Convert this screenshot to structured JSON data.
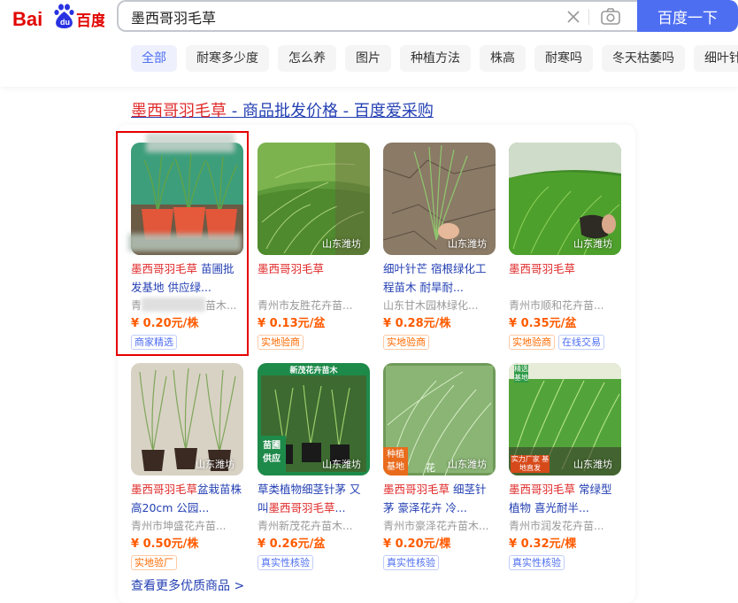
{
  "header": {
    "logo_text": "Bai百度",
    "search_value": "墨西哥羽毛草",
    "search_button": "百度一下",
    "tabs": [
      "全部",
      "耐寒多少度",
      "怎么养",
      "图片",
      "种植方法",
      "株高",
      "耐寒吗",
      "冬天枯萎吗",
      "细叶针"
    ]
  },
  "result": {
    "title_highlight": "墨西哥羽毛草",
    "title_rest": " - 商品批发价格 - 百度爱采购"
  },
  "products": [
    {
      "name_hl": "墨西哥羽毛草",
      "name_rest": " 苗圃批发基地 供应绿...",
      "shop": "青　　　　　　苗木...",
      "price": "¥ 0.20元/株",
      "badges": [
        {
          "text": "商家精选",
          "style": "blue"
        }
      ],
      "location": ""
    },
    {
      "name_hl": "墨西哥羽毛草",
      "name_rest": "",
      "shop": "青州市友胜花卉苗...",
      "price": "¥ 0.13元/盆",
      "badges": [
        {
          "text": "实地验商",
          "style": "orange"
        }
      ],
      "location": "山东潍坊"
    },
    {
      "name_hl": "",
      "name_rest": "细叶针芒 宿根绿化工程苗木 耐旱耐...",
      "shop": "山东甘木园林绿化...",
      "price": "¥ 0.28元/株",
      "badges": [
        {
          "text": "实地验商",
          "style": "orange"
        }
      ],
      "location": "山东潍坊"
    },
    {
      "name_hl": "墨西哥羽毛草",
      "name_rest": "",
      "shop": "青州市顺和花卉苗...",
      "price": "¥ 0.35元/盆",
      "badges": [
        {
          "text": "实地验商",
          "style": "orange"
        },
        {
          "text": "在线交易",
          "style": "blue"
        }
      ],
      "location": "山东潍坊"
    },
    {
      "name_hl": "墨西哥羽毛草",
      "name_rest": "盆栽苗株高20cm 公园...",
      "shop": "青州市坤盛花卉苗...",
      "price": "¥ 0.50元/株",
      "badges": [
        {
          "text": "实地验厂",
          "style": "orange"
        }
      ],
      "location": "山东潍坊"
    },
    {
      "name_pre": "草类植物细茎针茅 又叫",
      "name_hl": "墨西哥羽毛草",
      "name_rest": "...",
      "shop": "青州新茂花卉苗木...",
      "price": "¥ 0.26元/盆",
      "badges": [
        {
          "text": "真实性核验",
          "style": "blue"
        }
      ],
      "location": "山东潍坊",
      "overlay_top": "新茂花卉苗木",
      "overlay_left": "苗圃供应"
    },
    {
      "name_hl": "墨西哥羽毛草",
      "name_rest": " 细茎针茅 豪泽花卉 冷...",
      "shop": "青州市豪泽花卉苗木...",
      "price": "¥ 0.20元/棵",
      "badges": [
        {
          "text": "真实性核验",
          "style": "blue"
        }
      ],
      "location": "山东潍坊",
      "overlay_left": "种植基地",
      "overlay_mid": "花"
    },
    {
      "name_hl": "墨西哥羽毛草",
      "name_rest": " 常绿型植物 喜光耐半...",
      "shop": "青州市润发花卉苗...",
      "price": "¥ 0.32元/棵",
      "badges": [
        {
          "text": "真实性核验",
          "style": "blue"
        }
      ],
      "location": "山东潍坊",
      "overlay_left": "实力厂家 基地直发",
      "overlay_corner": "精选基地"
    }
  ],
  "more_link": "查看更多优质商品 >",
  "colors": {
    "brand_blue": "#4e6ef2",
    "link_blue": "#2440b3",
    "highlight_red": "#e02a2a",
    "price_orange": "#ff5a00",
    "box_red": "#e60000"
  }
}
